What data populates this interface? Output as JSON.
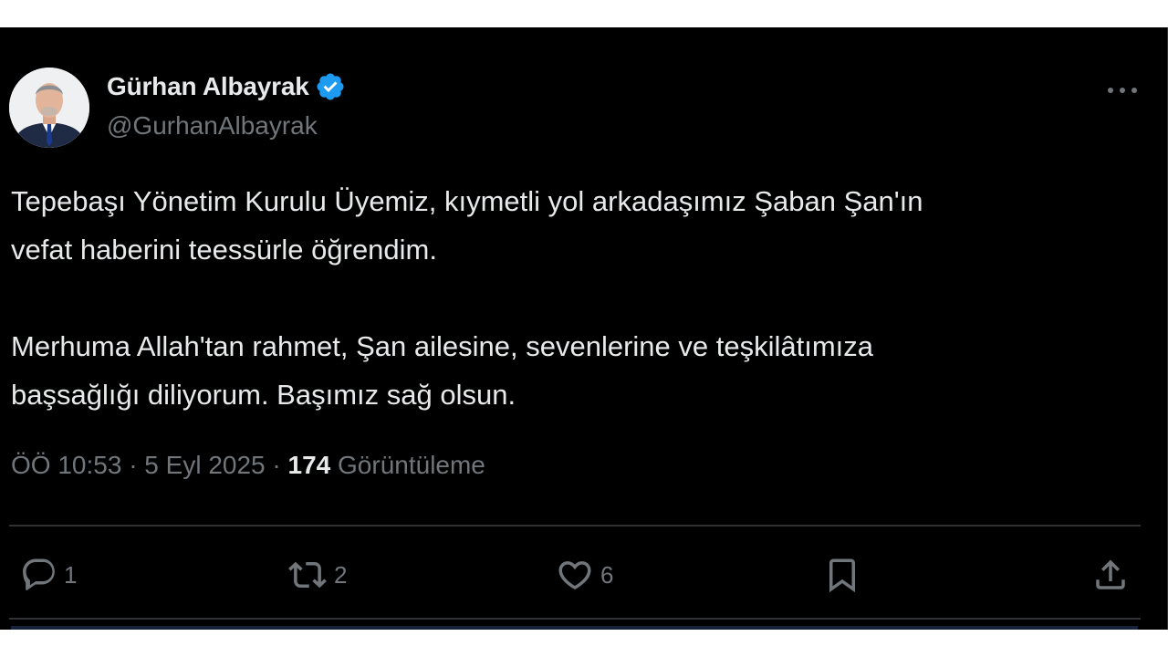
{
  "author": {
    "name": "Gürhan Albayrak",
    "handle": "@GurhanAlbayrak",
    "verified_color": "#1d9bf0"
  },
  "tweet": {
    "paragraphs": [
      [
        "Tepebaşı Yönetim Kurulu Üyemiz, kıymetli yol arkadaşımız Şaban Şan'ın",
        "vefat haberini teessürle öğrendim."
      ],
      [
        "Merhuma Allah'tan rahmet, Şan ailesine, sevenlerine ve teşkilâtımıza",
        "başsağlığı diliyorum. Başımız sağ olsun."
      ]
    ]
  },
  "meta": {
    "time": "ÖÖ 10:53",
    "separator": "·",
    "date": "5 Eyl 2025",
    "views_count": "174",
    "views_label": "Görüntüleme"
  },
  "actions": {
    "reply": {
      "icon": "reply-icon",
      "count": "1"
    },
    "retweet": {
      "icon": "retweet-icon",
      "count": "2"
    },
    "like": {
      "icon": "heart-icon",
      "count": "6"
    },
    "bookmark": {
      "icon": "bookmark-icon"
    },
    "share": {
      "icon": "share-icon"
    }
  },
  "colors": {
    "background": "#000000",
    "text": "#e7e9ea",
    "secondary_text": "#71767b",
    "divider": "#2f3336"
  }
}
